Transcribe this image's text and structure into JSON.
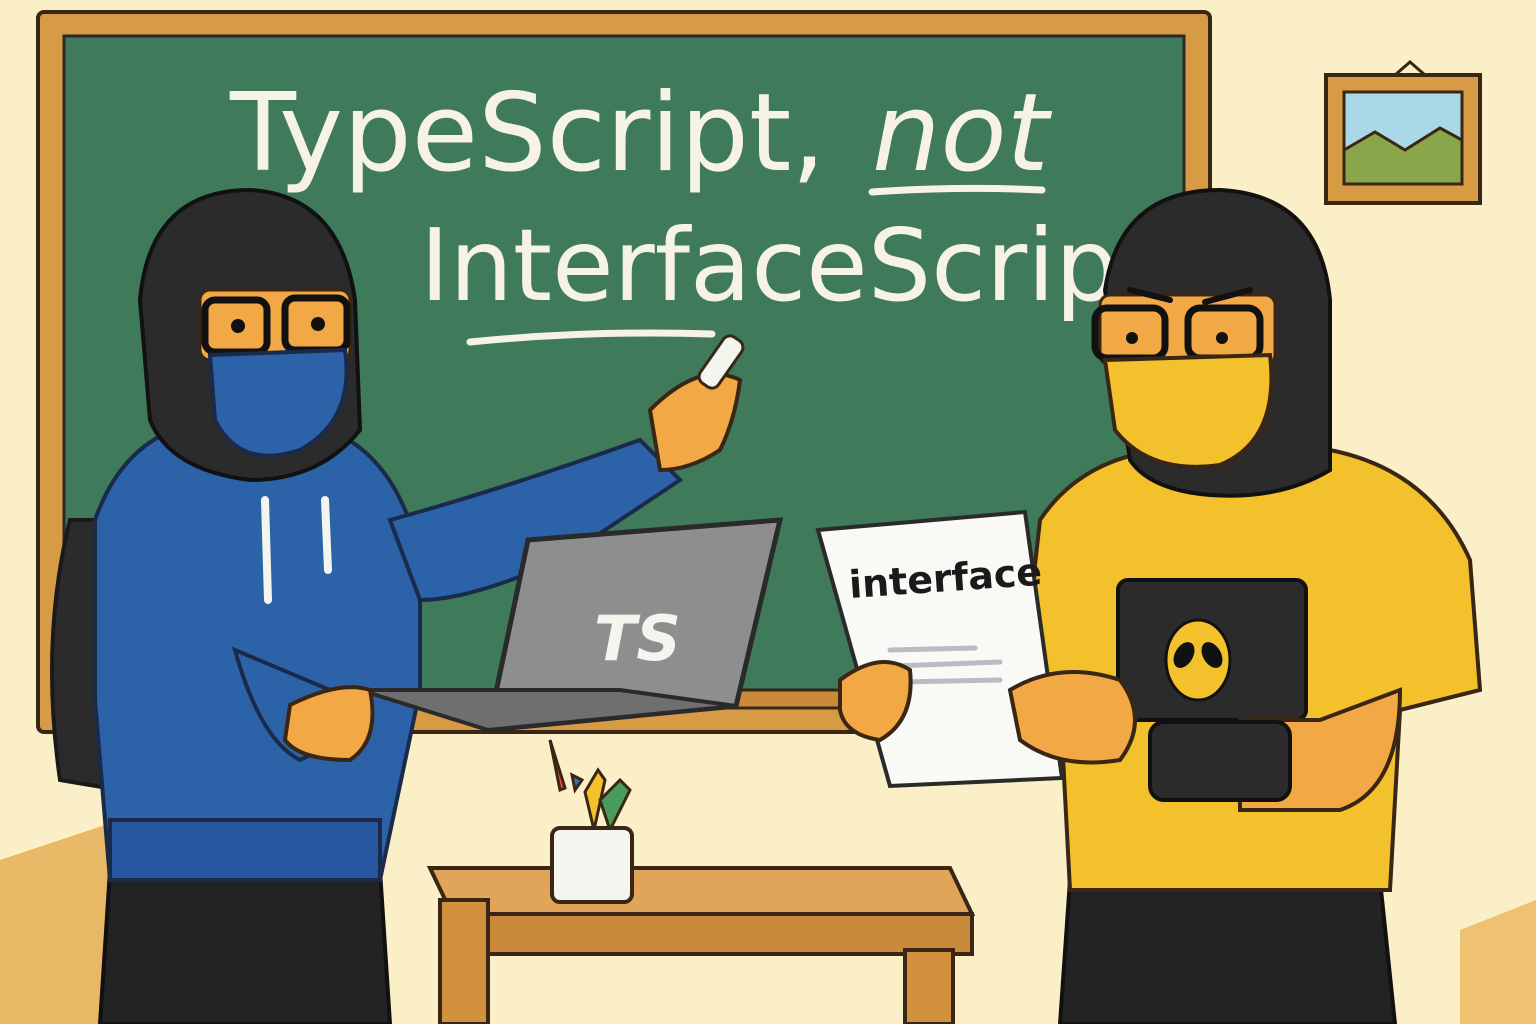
{
  "chalkboard": {
    "line1": "TypeScript,",
    "line1_emphasis": "not",
    "line2": "InterfaceScript"
  },
  "laptop": {
    "label": "TS"
  },
  "paper": {
    "label": "interface"
  },
  "colors": {
    "wall": "#fbefc7",
    "chalkboard": "#3f7a5a",
    "frame": "#d79a45",
    "hoodie": "#2c62a8",
    "tshirt": "#f2c12c",
    "mask_left": "#2c62a8",
    "mask_right": "#f2c12c",
    "skin": "#f2a945",
    "hood": "#2b2b2b",
    "laptop": "#8e8e8e",
    "desk": "#e1a55a"
  },
  "icons": [
    "alien-icon",
    "picture-frame-icon",
    "chalk-icon",
    "pencil-cup-icon"
  ]
}
